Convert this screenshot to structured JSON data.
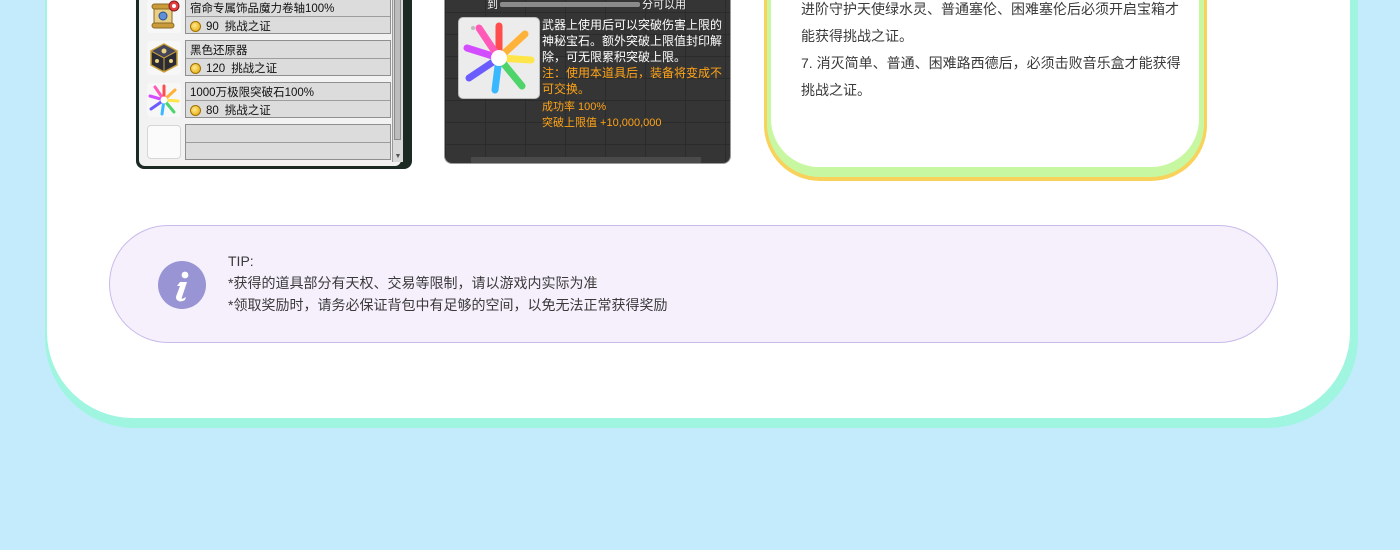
{
  "shop": {
    "items": [
      {
        "name": "宿命专属饰品魔力卷轴100%",
        "price": "90",
        "currency": "挑战之证",
        "icon": "scroll-icon"
      },
      {
        "name": "黑色还原器",
        "price": "120",
        "currency": "挑战之证",
        "icon": "black-cube-icon"
      },
      {
        "name": "1000万极限突破石100%",
        "price": "80",
        "currency": "挑战之证",
        "icon": "rainbow-stone-icon"
      }
    ]
  },
  "tooltip": {
    "top_left": "到",
    "top_right": "分可以用",
    "description": "武器上使用后可以突破伤害上限的神秘宝石。额外突破上限值封印解除，可无限累积突破上限。",
    "note": "注：使用本道具后，装备将变成不可交换。",
    "success_rate": "成功率 100%",
    "breakthrough": "突破上限值 +10,000,000",
    "accent_color": "#ffa317"
  },
  "rules": {
    "lines": [
      "进阶守护天使绿水灵、普通塞伦、困难塞伦后必须开启宝箱才能获得挑战之证。",
      "7. 消灭简单、普通、困难路西德后，必须击败音乐盒才能获得挑战之证。"
    ]
  },
  "tip": {
    "title": "TIP:",
    "lines": [
      "*获得的道具部分有天权、交易等限制，请以游戏内实际为准",
      "*领取奖励时，请务必保证背包中有足够的空间，以免无法正常获得奖励"
    ],
    "icon": "info-icon"
  },
  "colors": {
    "background": "#c3ebfc",
    "card_rim": "#9ff5e0",
    "rules_border": "#f8d25a",
    "tip_bg": "#f6f0fd",
    "info_icon": "#9994d4"
  }
}
